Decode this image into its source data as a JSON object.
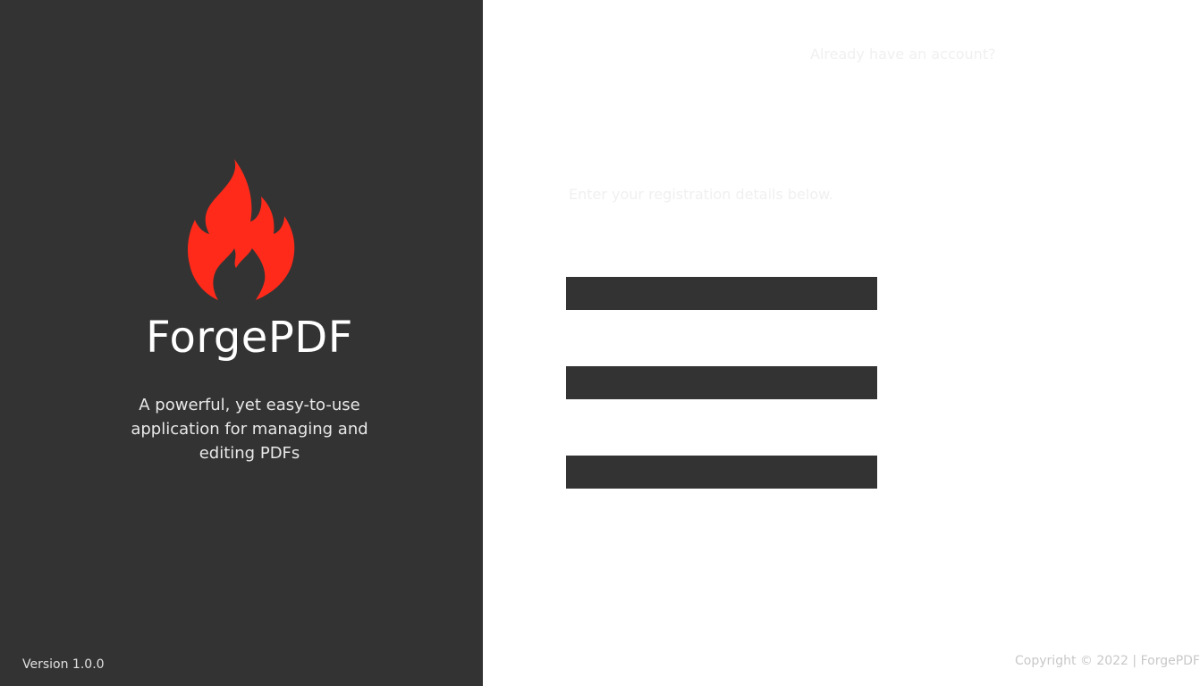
{
  "brand": {
    "app_name": "ForgePDF",
    "tagline": "A powerful, yet easy-to-use application for managing and editing PDFs",
    "logo_icon": "flame-icon",
    "logo_color": "#ff2a1a",
    "panel_color": "#333333",
    "version": "Version 1.0.0"
  },
  "form": {
    "login_prompt": "Already have an account?",
    "instructions": "Enter your registration details below.",
    "fields": [
      {
        "value": "",
        "placeholder": ""
      },
      {
        "value": "",
        "placeholder": ""
      },
      {
        "value": "",
        "placeholder": ""
      }
    ],
    "field_color": "#333333"
  },
  "footer": {
    "copyright": "Copyright © 2022 | ForgePDF"
  }
}
